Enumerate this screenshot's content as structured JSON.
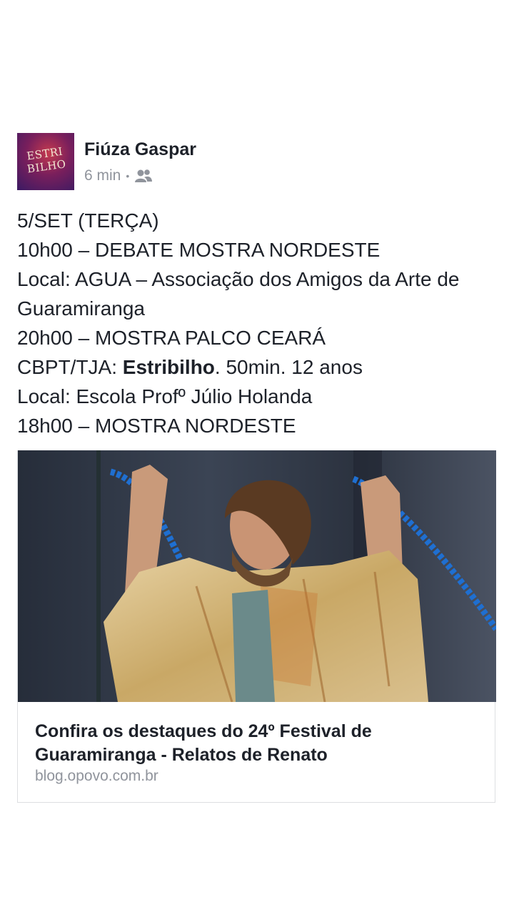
{
  "post": {
    "avatar_text": [
      "ESTRI",
      "BILHO"
    ],
    "author": "Fiúza Gaspar",
    "time": "6 min",
    "separator": "•",
    "audience_icon": "friends-icon",
    "lines": {
      "l1": "5/SET (TERÇA)",
      "l2": "10h00 – DEBATE MOSTRA NORDESTE",
      "l3": "Local: AGUA – Associação dos Amigos da Arte de Guaramiranga",
      "l4": "20h00 – MOSTRA PALCO CEARÁ",
      "l5_prefix": "CBPT/TJA: ",
      "l5_bold": "Estribilho",
      "l5_suffix": ". 50min. 12 anos",
      "l6": "Local: Escola Profº Júlio Holanda",
      "l7": "18h00 – MOSTRA NORDESTE"
    }
  },
  "link_card": {
    "image_description_icon": "photo-performer-icon",
    "title": "Confira os destaques do 24º Festival de Guaramiranga - Relatos de Renato",
    "domain": "blog.opovo.com.br"
  },
  "colors": {
    "text": "#1d2129",
    "meta": "#90949c",
    "border": "#dddfe2",
    "rope": "#1f6fd1"
  }
}
